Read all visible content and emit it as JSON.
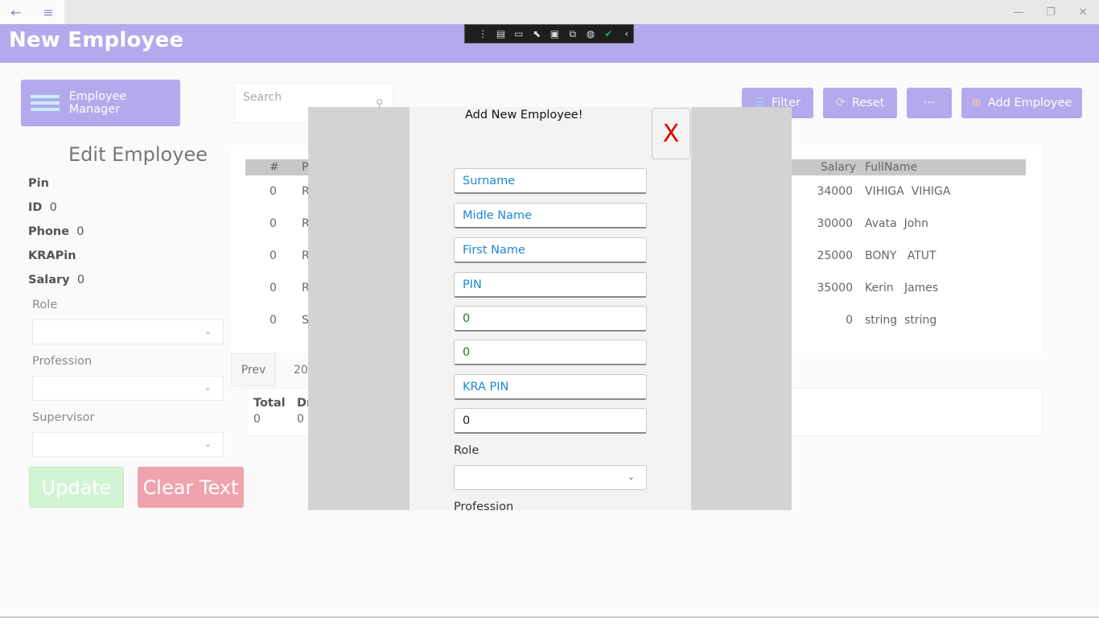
{
  "window": {
    "title": "New Employee",
    "back_icon": "←",
    "menu_icon": "≡",
    "minimize_icon": "—",
    "restore_icon": "❐",
    "close_icon": "✕"
  },
  "devtools": {
    "icons": [
      "⋮",
      "▤",
      "▭",
      "⬉",
      "▣",
      "⧉",
      "◍",
      "✔",
      "‹"
    ],
    "colors": {
      "check": "#2ba84a"
    }
  },
  "sidebar": {
    "app_button_label": "Employee Manager",
    "edit_title": "Edit Employee",
    "fields": [
      {
        "label": "Pin",
        "value": ""
      },
      {
        "label": "ID",
        "value": "0"
      },
      {
        "label": "Phone",
        "value": "0"
      },
      {
        "label": "KRAPin",
        "value": ""
      },
      {
        "label": "Salary",
        "value": "0"
      }
    ],
    "selects": [
      {
        "label": "Role",
        "value": ""
      },
      {
        "label": "Profession",
        "value": ""
      },
      {
        "label": "Supervisor",
        "value": ""
      }
    ],
    "update_label": "Update",
    "clear_label": "Clear Text"
  },
  "toolbar": {
    "search_placeholder": "Search",
    "filter_label": "Filter",
    "reset_label": "Reset",
    "more_label": "···",
    "add_label": "Add Employee"
  },
  "table": {
    "headers": {
      "index": "#",
      "pin_partial": "P",
      "salary": "Salary",
      "fullname": "FullName"
    },
    "rows": [
      {
        "index": "0",
        "pin_partial": "R",
        "salary": "34000",
        "fullname": "VIHIGA  VIHIGA"
      },
      {
        "index": "0",
        "pin_partial": "R",
        "salary": "30000",
        "fullname": "Avata  John"
      },
      {
        "index": "0",
        "pin_partial": "R",
        "salary": "25000",
        "fullname": "BONY   ATUT"
      },
      {
        "index": "0",
        "pin_partial": "R",
        "salary": "35000",
        "fullname": "Kerin   James"
      },
      {
        "index": "0",
        "pin_partial": "S",
        "salary": "0",
        "fullname": "string  string"
      }
    ]
  },
  "pagination": {
    "prev_label": "Prev",
    "page_size": "20"
  },
  "summary": {
    "headers": [
      "Total",
      "Dr"
    ],
    "values": [
      "0",
      "0"
    ]
  },
  "modal": {
    "title": "Add New Employee!",
    "close_label": "X",
    "inputs": [
      {
        "kind": "placeholder",
        "text": "Surname"
      },
      {
        "kind": "placeholder",
        "text": "Midle Name"
      },
      {
        "kind": "placeholder",
        "text": "First Name"
      },
      {
        "kind": "placeholder",
        "text": "PIN"
      },
      {
        "kind": "value",
        "text": "0"
      },
      {
        "kind": "value",
        "text": "0"
      },
      {
        "kind": "placeholder",
        "text": "KRA PIN"
      },
      {
        "kind": "value-dark",
        "text": "0"
      }
    ],
    "role_label": "Role",
    "role_value": "",
    "profession_label": "Profession"
  },
  "colors": {
    "accent": "#b4a9ec",
    "update": "#d2f4d2",
    "clear": "#f0a3ac",
    "close_x": "#e00000",
    "placeholder_text": "#1e88d2",
    "value_text": "#1f7a1f"
  }
}
